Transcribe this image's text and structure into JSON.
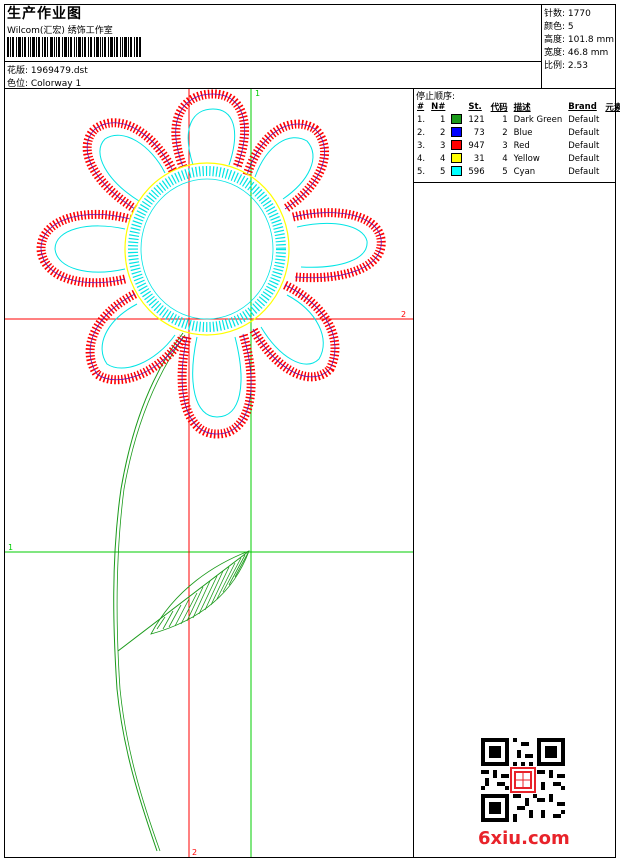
{
  "header": {
    "title": "生产作业图",
    "company": "Wilcom(汇宏) 绣饰工作室",
    "design_label": "花版: 1969479.dst",
    "colorway_label": "色位: Colorway 1"
  },
  "stats": {
    "stitches": "针数: 1770",
    "colors": "颜色: 5",
    "height": "高度: 101.8 mm",
    "width": "宽度: 46.8 mm",
    "ratio": "比例: 2.53"
  },
  "sequence": {
    "heading": "停止顺序:",
    "columns": [
      "#",
      "N#",
      "St.",
      "代码",
      "描述",
      "Brand",
      "元素"
    ],
    "rows": [
      {
        "idx": "1.",
        "n": "1",
        "color": "#1a9a1a",
        "st": "121",
        "code": "1",
        "desc": "Dark Green",
        "brand": "Default"
      },
      {
        "idx": "2.",
        "n": "2",
        "color": "#0000ff",
        "st": "73",
        "code": "2",
        "desc": "Blue",
        "brand": "Default"
      },
      {
        "idx": "3.",
        "n": "3",
        "color": "#ff0000",
        "st": "947",
        "code": "3",
        "desc": "Red",
        "brand": "Default"
      },
      {
        "idx": "4.",
        "n": "4",
        "color": "#ffff00",
        "st": "31",
        "code": "4",
        "desc": "Yellow",
        "brand": "Default"
      },
      {
        "idx": "5.",
        "n": "5",
        "color": "#00ffff",
        "st": "596",
        "code": "5",
        "desc": "Cyan",
        "brand": "Default"
      }
    ]
  },
  "guides": {
    "top_label": "1",
    "right_label": "2",
    "left_label": "1",
    "bottom_label": "2",
    "color_green": "#00cc00",
    "color_red": "#ff0000"
  },
  "watermark": "6xiu.com"
}
